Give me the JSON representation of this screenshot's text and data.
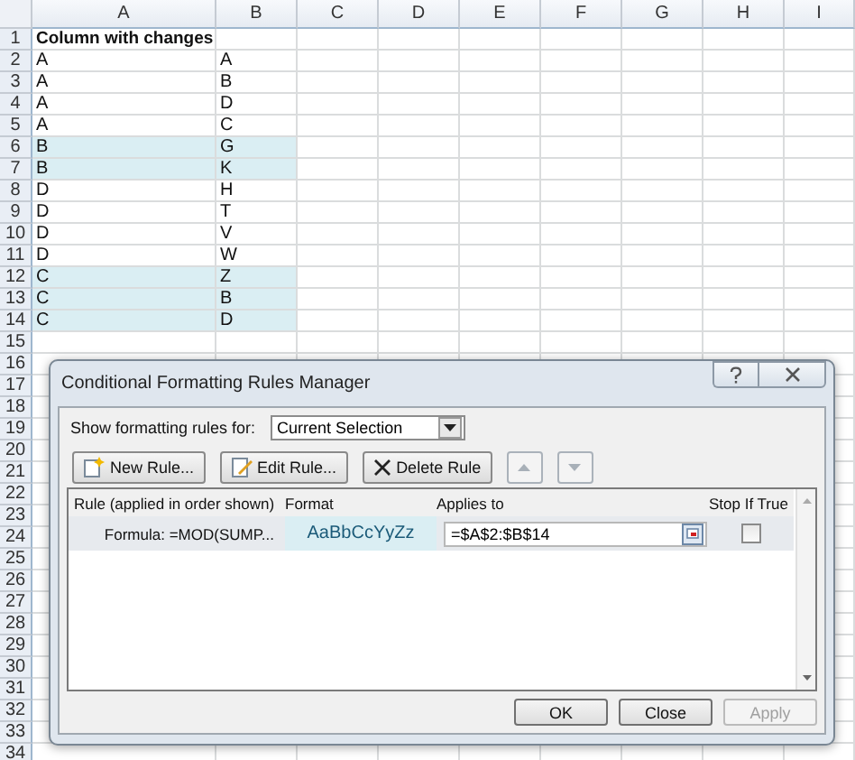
{
  "sheet": {
    "columns": [
      "A",
      "B",
      "C",
      "D",
      "E",
      "F",
      "G",
      "H",
      "I"
    ],
    "rows": [
      {
        "number": "1",
        "a": "Column with changes",
        "highlighted": false
      },
      {
        "number": "2",
        "a": "A",
        "b": "A",
        "highlighted": false
      },
      {
        "number": "3",
        "a": "A",
        "b": "B",
        "highlighted": false
      },
      {
        "number": "4",
        "a": "A",
        "b": "D",
        "highlighted": false
      },
      {
        "number": "5",
        "a": "A",
        "b": "C",
        "highlighted": false
      },
      {
        "number": "6",
        "a": "B",
        "b": "G",
        "highlighted": true
      },
      {
        "number": "7",
        "a": "B",
        "b": "K",
        "highlighted": true
      },
      {
        "number": "8",
        "a": "D",
        "b": "H",
        "highlighted": false
      },
      {
        "number": "9",
        "a": "D",
        "b": "T",
        "highlighted": false
      },
      {
        "number": "10",
        "a": "D",
        "b": "V",
        "highlighted": false
      },
      {
        "number": "11",
        "a": "D",
        "b": "W",
        "highlighted": false
      },
      {
        "number": "12",
        "a": "C",
        "b": "Z",
        "highlighted": true
      },
      {
        "number": "13",
        "a": "C",
        "b": "B",
        "highlighted": true
      },
      {
        "number": "14",
        "a": "C",
        "b": "D",
        "highlighted": true
      },
      {
        "number": "15",
        "highlighted": false
      },
      {
        "number": "16",
        "highlighted": false
      },
      {
        "number": "17",
        "highlighted": false
      },
      {
        "number": "18",
        "highlighted": false
      },
      {
        "number": "19",
        "highlighted": false
      },
      {
        "number": "20",
        "highlighted": false
      },
      {
        "number": "21",
        "highlighted": false
      },
      {
        "number": "22",
        "highlighted": false
      },
      {
        "number": "23",
        "highlighted": false
      },
      {
        "number": "24",
        "highlighted": false
      },
      {
        "number": "25",
        "highlighted": false
      },
      {
        "number": "26",
        "highlighted": false
      },
      {
        "number": "27",
        "highlighted": false
      },
      {
        "number": "28",
        "highlighted": false
      },
      {
        "number": "29",
        "highlighted": false
      },
      {
        "number": "30",
        "highlighted": false
      },
      {
        "number": "31",
        "highlighted": false
      },
      {
        "number": "32",
        "highlighted": false
      },
      {
        "number": "33",
        "highlighted": false
      },
      {
        "number": "34",
        "highlighted": false
      }
    ]
  },
  "dialog": {
    "title": "Conditional Formatting Rules Manager",
    "show_rules_for": {
      "label": "Show formatting rules for:",
      "value": "Current Selection"
    },
    "toolbar": [
      {
        "label": "New Rule...",
        "kind": "new",
        "disabled": false
      },
      {
        "label": "Edit Rule...",
        "kind": "edit",
        "disabled": false
      },
      {
        "label": "Delete Rule",
        "kind": "delete",
        "disabled": false
      },
      {
        "kind": "up",
        "disabled": true
      },
      {
        "kind": "down",
        "disabled": true
      }
    ],
    "table": {
      "columns": [
        "Rule (applied in order shown)",
        "Format",
        "Applies to",
        "Stop If True"
      ],
      "rows": [
        {
          "rule": "Formula: =MOD(SUMP...",
          "format": "AaBbCcYyZz",
          "applies_to": "=$A$2:$B$14",
          "stop_if_true": false,
          "selected": true
        }
      ]
    },
    "buttons": [
      {
        "label": "OK",
        "disabled": false
      },
      {
        "label": "Close",
        "disabled": false
      },
      {
        "label": "Apply",
        "disabled": true
      }
    ]
  }
}
